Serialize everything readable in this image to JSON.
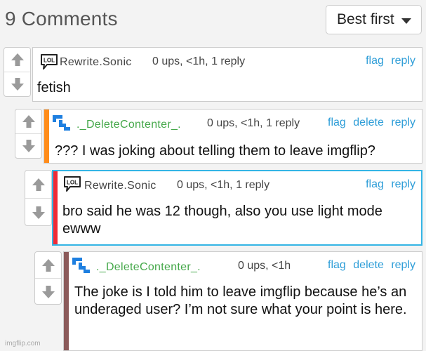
{
  "header": {
    "title": "9 Comments"
  },
  "sort": {
    "selected": "Best first"
  },
  "comments": [
    {
      "username": "Rewrite.Sonic",
      "meta": "0 ups, <1h, 1 reply",
      "actions": [
        "flag",
        "reply"
      ],
      "body": "fetish",
      "avatar": "lol-icon",
      "bar_color": ""
    },
    {
      "username": "._DeleteContenter_.",
      "meta": "0 ups, <1h, 1 reply",
      "actions": [
        "flag",
        "delete",
        "reply"
      ],
      "body": "??? I was joking about telling them to leave imgflip?",
      "avatar": "blocks-icon",
      "bar_color": "#ff8c1a"
    },
    {
      "username": "Rewrite.Sonic",
      "meta": "0 ups, <1h, 1 reply",
      "actions": [
        "flag",
        "reply"
      ],
      "body": "bro said he was 12 though, also you use light mode ewww",
      "avatar": "lol-icon",
      "bar_color": "#f02a35"
    },
    {
      "username": "._DeleteContenter_.",
      "meta": "0 ups, <1h",
      "actions": [
        "flag",
        "delete",
        "reply"
      ],
      "body": "The joke is I told him to leave imgflip because he’s an underaged user? I’m not sure what your point is here.",
      "avatar": "blocks-icon",
      "bar_color": "#8b5a5a"
    }
  ],
  "colors": {
    "link": "#2f9ed8",
    "username_green": "#45a84a",
    "username_gray": "#444444",
    "highlight_border": "#34b5e5"
  },
  "watermark": "imgflip.com"
}
